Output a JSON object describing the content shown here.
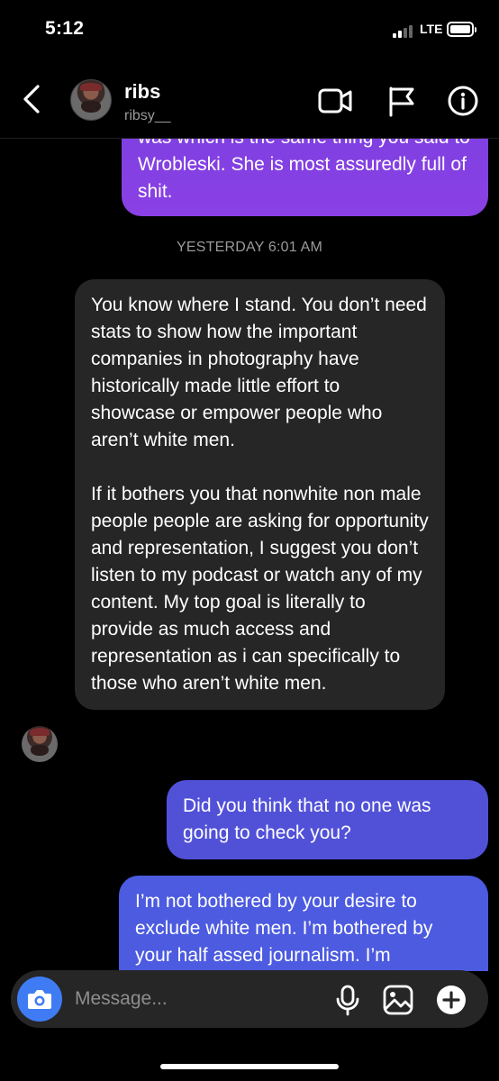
{
  "status_bar": {
    "time": "5:12",
    "network": "LTE",
    "battery_level": 1.0
  },
  "header": {
    "name": "ribs",
    "username": "ribsy__",
    "icons": [
      "back-chevron-icon",
      "video-call-icon",
      "flag-icon",
      "info-icon"
    ]
  },
  "conversation": {
    "sent_1": "was which is the same thing you said to Wrobleski. She is most assuredly full of shit.",
    "timestamp": "YESTERDAY 6:01 AM",
    "received_paragraph_1": "You know where I stand. You don’t need stats to show how the important companies in photography have historically made little effort to showcase or empower people who aren’t white men.",
    "received_paragraph_2": "If it bothers you that nonwhite non male people people are asking for opportunity and representation, I suggest you don’t listen to my podcast or watch any of my content. My top goal is literally to provide as much access and representation as i can specifically to those who aren’t white men.",
    "sent_2": "Did you think that no one was going to check you?",
    "sent_3": "I’m not bothered by your desire to exclude white men. I’m bothered by your half assed journalism. I’m"
  },
  "composer": {
    "placeholder": "Message...",
    "icons": [
      "camera-icon",
      "microphone-icon",
      "gallery-icon",
      "plus-icon"
    ]
  },
  "colors": {
    "sent_gradient_top": "#7b3fe0",
    "sent_mid": "#5151d8",
    "sent_bottom": "#4c5be0",
    "received": "#262626",
    "camera_button": "#3f7cf3"
  }
}
